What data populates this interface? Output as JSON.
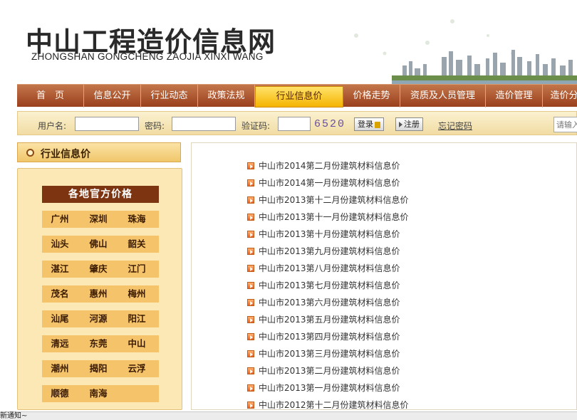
{
  "site": {
    "title_cn": "中山工程造价信息网",
    "title_en": "ZHONGSHAN GONGCHENG ZAOJIA XINXI WANG"
  },
  "nav": {
    "items": [
      {
        "label": "首　页"
      },
      {
        "label": "信息公开"
      },
      {
        "label": "行业动态"
      },
      {
        "label": "政策法规"
      },
      {
        "label": "行业信息价",
        "active": true
      },
      {
        "label": "价格走势"
      },
      {
        "label": "资质及人员管理"
      },
      {
        "label": "造价管理"
      },
      {
        "label": "造价分"
      }
    ]
  },
  "login": {
    "username_label": "用户名:",
    "username_value": "",
    "password_label": "密码:",
    "password_value": "",
    "captcha_label": "验证码:",
    "captcha_value": "",
    "captcha_image_text": "6520",
    "login_button": "登录",
    "register_button": "注册",
    "forgot_link": "忘记密码",
    "search_placeholder": "请输入"
  },
  "sidebar": {
    "header": "行业信息价",
    "box_title": "各地官方价格",
    "city_rows": [
      [
        "广州",
        "深圳",
        "珠海"
      ],
      [
        "汕头",
        "佛山",
        "韶关"
      ],
      [
        "湛江",
        "肇庆",
        "江门"
      ],
      [
        "茂名",
        "惠州",
        "梅州"
      ],
      [
        "汕尾",
        "河源",
        "阳江"
      ],
      [
        "清远",
        "东莞",
        "中山"
      ],
      [
        "潮州",
        "揭阳",
        "云浮"
      ],
      [
        "顺德",
        "南海",
        ""
      ]
    ]
  },
  "list": {
    "items": [
      "中山市2014第二月份建筑材料信息价",
      "中山市2014第一月份建筑材料信息价",
      "中山市2013第十二月份建筑材料信息价",
      "中山市2013第十一月份建筑材料信息价",
      "中山市2013第十月份建筑材料信息价",
      "中山市2013第九月份建筑材料信息价",
      "中山市2013第八月份建筑材料信息价",
      "中山市2013第七月份建筑材料信息价",
      "中山市2013第六月份建筑材料信息价",
      "中山市2013第五月份建筑材料信息价",
      "中山市2013第四月份建筑材料信息价",
      "中山市2013第三月份建筑材料信息价",
      "中山市2013第二月份建筑材料信息价",
      "中山市2013第一月份建筑材料信息价",
      "中山市2012第十二月份建筑材料信息价"
    ]
  },
  "statusbar": {
    "text": "新通知~"
  },
  "colors": {
    "nav_bg": "#9a3f1d",
    "nav_active": "#f5b400",
    "sidebar_bg": "#fbe8b4",
    "city_btn": "#f5c46a",
    "box_title_bg": "#7d3511"
  }
}
